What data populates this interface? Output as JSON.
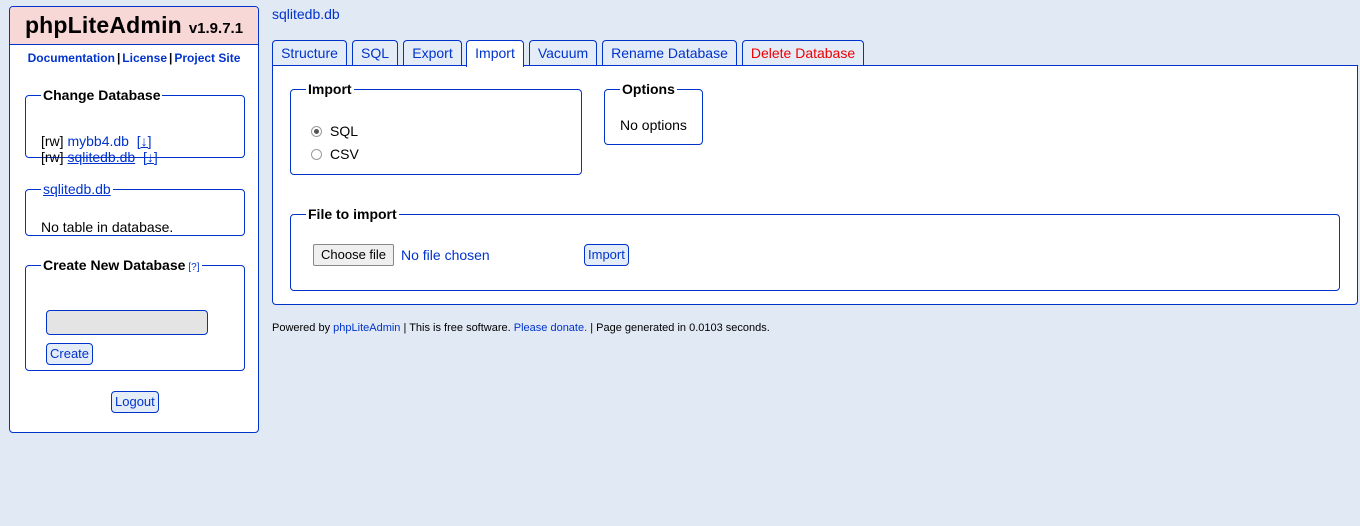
{
  "sidebar": {
    "app_name": "phpLiteAdmin",
    "version": "v1.9.7.1",
    "links": [
      "Documentation",
      "License",
      "Project Site"
    ],
    "change_db": {
      "legend": "Change Database",
      "databases": [
        {
          "mode": "[rw]",
          "name": "mybb4.db",
          "download": "[↓]"
        },
        {
          "mode": "[rw]",
          "name": "sqlitedb.db",
          "download": "[↓]"
        }
      ]
    },
    "current_db": {
      "legend": "sqlitedb.db",
      "message": "No table in database."
    },
    "create_db": {
      "legend": "Create New Database",
      "help": "[?]",
      "input_value": "",
      "button": "Create"
    },
    "logout": "Logout"
  },
  "main": {
    "breadcrumb": "sqlitedb.db",
    "tabs": [
      "Structure",
      "SQL",
      "Export",
      "Import",
      "Vacuum",
      "Rename Database",
      "Delete Database"
    ],
    "active_tab": "Import",
    "import_box": {
      "legend": "Import",
      "options": [
        "SQL",
        "CSV"
      ],
      "selected": "SQL"
    },
    "options_box": {
      "legend": "Options",
      "message": "No options"
    },
    "file_box": {
      "legend": "File to import",
      "choose_label": "Choose file",
      "file_status": "No file chosen",
      "import_button": "Import"
    }
  },
  "footer": {
    "powered_by": "Powered by",
    "app_link": "phpLiteAdmin",
    "free_text": "| This is free software.",
    "donate": "Please donate.",
    "generated": "| Page generated in 0.0103 seconds."
  },
  "colors": {
    "background": "#e0e9f4",
    "accent": "#0033cc",
    "logo_bg": "#f8d7d7",
    "danger": "#ee0000"
  }
}
